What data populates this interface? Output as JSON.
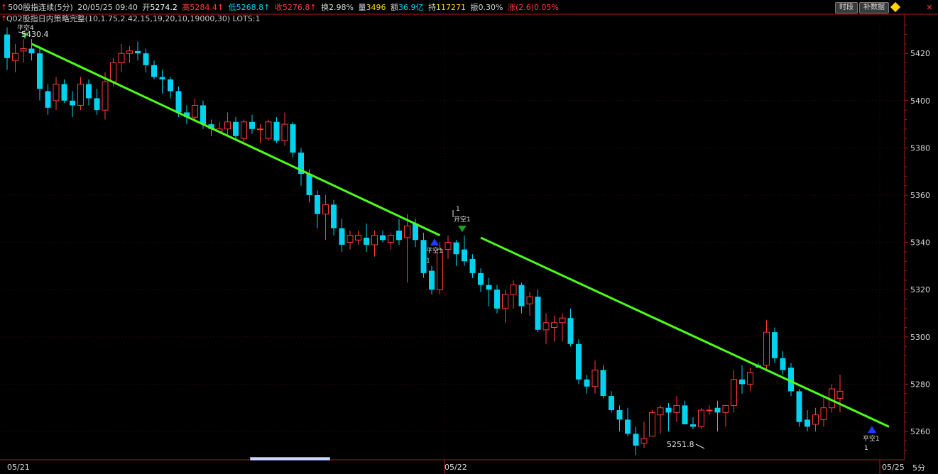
{
  "header": {
    "name": "500股指连续(5分)",
    "datetime": "20/05/25 09:40",
    "open_label": "开",
    "open_value": "5274.2",
    "high_label": "高",
    "high_value": "5284.4",
    "low_label": "低",
    "low_value": "5268.8",
    "close_label": "收",
    "close_value": "5276.8",
    "turnover_label": "换",
    "turnover_value": "2.98%",
    "volume_label": "量",
    "volume_value": "3496",
    "amount_label": "额",
    "amount_value": "36.9亿",
    "position_label": "持",
    "position_value": "117271",
    "amplitude_label": "振",
    "amplitude_value": "0.30%",
    "change_label": "涨",
    "change_value": "(2.6)",
    "change_pct": "0.05%"
  },
  "indicator_line": "Q02股指日内策略完整(10,1.75,2.42,15,19,20,10,19000,30)  LOTS:1",
  "toolbar": {
    "time_label": "时段",
    "fill_label": "补数据"
  },
  "period_label": "5分",
  "colors": {
    "up": "#ff3b3b",
    "down": "#00d2f0",
    "trend": "#4cff19",
    "axis": "#b01818",
    "grid": "#3a0d0d"
  },
  "chart_data": {
    "type": "candlestick",
    "y_axis_ticks": [
      5420,
      5400,
      5380,
      5360,
      5340,
      5320,
      5300,
      5280,
      5260
    ],
    "ylim": [
      5248,
      5436
    ],
    "x_tick_labels": [
      "05/21",
      "05/22",
      "05/25"
    ],
    "annotations": {
      "high_label": "5430.4",
      "low_label": "5251.8",
      "signals": [
        {
          "text": "平空4",
          "type": "sell"
        },
        {
          "text": "平空1",
          "qty": "1",
          "type": "buy"
        },
        {
          "text": "开空1",
          "qty": "1",
          "type": "sell"
        },
        {
          "text": "平空1",
          "qty": "1",
          "type": "buy"
        }
      ]
    },
    "trend_lines": [
      {
        "from": {
          "bar": 3,
          "price": 5424
        },
        "to": {
          "bar": 53,
          "price": 5343
        }
      },
      {
        "from": {
          "bar": 58,
          "price": 5342
        },
        "to": {
          "bar": 108,
          "price": 5262
        }
      }
    ],
    "candles": [
      [
        5428,
        5431,
        5413,
        5418
      ],
      [
        5417,
        5424,
        5412,
        5420
      ],
      [
        5421,
        5426,
        5416,
        5422
      ],
      [
        5422,
        5426,
        5417,
        5420
      ],
      [
        5420,
        5423,
        5400,
        5405
      ],
      [
        5404,
        5407,
        5394,
        5397
      ],
      [
        5400,
        5410,
        5396,
        5407
      ],
      [
        5407,
        5409,
        5399,
        5400
      ],
      [
        5400,
        5404,
        5393,
        5398
      ],
      [
        5398,
        5410,
        5396,
        5407
      ],
      [
        5407,
        5409,
        5398,
        5401
      ],
      [
        5401,
        5405,
        5394,
        5396
      ],
      [
        5396,
        5412,
        5392,
        5408
      ],
      [
        5408,
        5418,
        5406,
        5416
      ],
      [
        5416,
        5424,
        5412,
        5420
      ],
      [
        5420,
        5423,
        5416,
        5421
      ],
      [
        5421,
        5425,
        5417,
        5420
      ],
      [
        5420,
        5422,
        5412,
        5415
      ],
      [
        5415,
        5417,
        5409,
        5410
      ],
      [
        5410,
        5413,
        5403,
        5409
      ],
      [
        5409,
        5410,
        5401,
        5404
      ],
      [
        5404,
        5406,
        5393,
        5395
      ],
      [
        5395,
        5398,
        5390,
        5393
      ],
      [
        5393,
        5401,
        5391,
        5398
      ],
      [
        5398,
        5400,
        5388,
        5390
      ],
      [
        5390,
        5392,
        5385,
        5388
      ],
      [
        5387,
        5391,
        5386,
        5388
      ],
      [
        5388,
        5395,
        5385,
        5391
      ],
      [
        5391,
        5393,
        5383,
        5385
      ],
      [
        5384,
        5392,
        5382,
        5391
      ],
      [
        5391,
        5394,
        5386,
        5388
      ],
      [
        5388,
        5390,
        5382,
        5388
      ],
      [
        5384,
        5392,
        5383,
        5391
      ],
      [
        5391,
        5393,
        5382,
        5383
      ],
      [
        5383,
        5395,
        5381,
        5390
      ],
      [
        5390,
        5391,
        5376,
        5378
      ],
      [
        5378,
        5380,
        5364,
        5369
      ],
      [
        5369,
        5371,
        5357,
        5360
      ],
      [
        5360,
        5362,
        5346,
        5352
      ],
      [
        5352,
        5360,
        5341,
        5356
      ],
      [
        5356,
        5358,
        5343,
        5346
      ],
      [
        5346,
        5350,
        5336,
        5339
      ],
      [
        5340,
        5345,
        5337,
        5343
      ],
      [
        5341,
        5345,
        5339,
        5343
      ],
      [
        5342,
        5348,
        5336,
        5339
      ],
      [
        5339,
        5345,
        5334,
        5343
      ],
      [
        5343,
        5345,
        5340,
        5341
      ],
      [
        5340,
        5344,
        5337,
        5343
      ],
      [
        5345,
        5350,
        5339,
        5341
      ],
      [
        5342,
        5352,
        5323,
        5347
      ],
      [
        5348,
        5350,
        5338,
        5341
      ],
      [
        5341,
        5344,
        5325,
        5327
      ],
      [
        5328,
        5330,
        5318,
        5320
      ],
      [
        5320,
        5340,
        5318,
        5337
      ],
      [
        5337,
        5343,
        5333,
        5340
      ],
      [
        5340,
        5341,
        5330,
        5335
      ],
      [
        5337,
        5343,
        5330,
        5332
      ],
      [
        5333,
        5335,
        5325,
        5327
      ],
      [
        5327,
        5329,
        5319,
        5322
      ],
      [
        5322,
        5325,
        5313,
        5320
      ],
      [
        5320,
        5322,
        5310,
        5312
      ],
      [
        5312,
        5320,
        5306,
        5318
      ],
      [
        5318,
        5324,
        5312,
        5322
      ],
      [
        5322,
        5323,
        5310,
        5313
      ],
      [
        5314,
        5319,
        5309,
        5317
      ],
      [
        5317,
        5320,
        5302,
        5303
      ],
      [
        5303,
        5310,
        5297,
        5306
      ],
      [
        5304,
        5309,
        5298,
        5306
      ],
      [
        5306,
        5310,
        5298,
        5308
      ],
      [
        5308,
        5312,
        5296,
        5297
      ],
      [
        5297,
        5299,
        5280,
        5282
      ],
      [
        5282,
        5284,
        5276,
        5279
      ],
      [
        5279,
        5290,
        5276,
        5286
      ],
      [
        5286,
        5288,
        5274,
        5275
      ],
      [
        5275,
        5277,
        5268,
        5269
      ],
      [
        5269,
        5271,
        5260,
        5265
      ],
      [
        5265,
        5270,
        5258,
        5259
      ],
      [
        5259,
        5262,
        5250,
        5254
      ],
      [
        5255,
        5264,
        5253,
        5257
      ],
      [
        5258,
        5269,
        5258,
        5268
      ],
      [
        5267,
        5271,
        5259,
        5270
      ],
      [
        5270,
        5272,
        5260,
        5268
      ],
      [
        5268,
        5275,
        5264,
        5271
      ],
      [
        5271,
        5273,
        5263,
        5263
      ],
      [
        5263,
        5266,
        5261,
        5262
      ],
      [
        5262,
        5270,
        5261,
        5269
      ],
      [
        5269,
        5271,
        5267,
        5269
      ],
      [
        5270,
        5273,
        5260,
        5268
      ],
      [
        5268,
        5271,
        5262,
        5271
      ],
      [
        5271,
        5286,
        5268,
        5282
      ],
      [
        5282,
        5288,
        5276,
        5280
      ],
      [
        5280,
        5287,
        5277,
        5285
      ],
      [
        5288,
        5289,
        5287,
        5287
      ],
      [
        5288,
        5307,
        5286,
        5302
      ],
      [
        5302,
        5304,
        5289,
        5291
      ],
      [
        5291,
        5294,
        5284,
        5286
      ],
      [
        5287,
        5289,
        5275,
        5277
      ],
      [
        5277,
        5278,
        5262,
        5264
      ],
      [
        5265,
        5269,
        5260,
        5262
      ],
      [
        5263,
        5270,
        5260,
        5267
      ],
      [
        5265,
        5275,
        5262,
        5270
      ],
      [
        5270,
        5280,
        5268,
        5278
      ],
      [
        5274,
        5284,
        5268,
        5277
      ]
    ]
  }
}
